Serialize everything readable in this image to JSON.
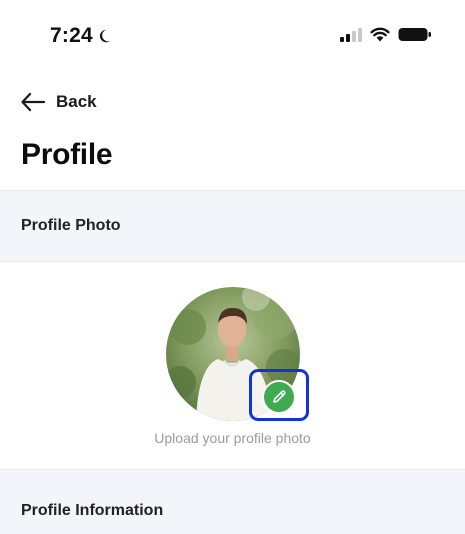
{
  "status_bar": {
    "time": "7:24",
    "moon_icon": "moon-icon",
    "signal_icon": "cellular-signal-icon",
    "wifi_icon": "wifi-icon",
    "battery_icon": "battery-icon"
  },
  "nav": {
    "back_label": "Back",
    "back_icon": "arrow-left-icon"
  },
  "page": {
    "title": "Profile"
  },
  "sections": {
    "photo": {
      "header": "Profile Photo",
      "upload_caption": "Upload your profile photo",
      "edit_icon": "pencil-icon",
      "edit_badge_color": "#3faa50",
      "highlight_color": "#1034d8"
    },
    "info": {
      "header": "Profile Information"
    }
  }
}
